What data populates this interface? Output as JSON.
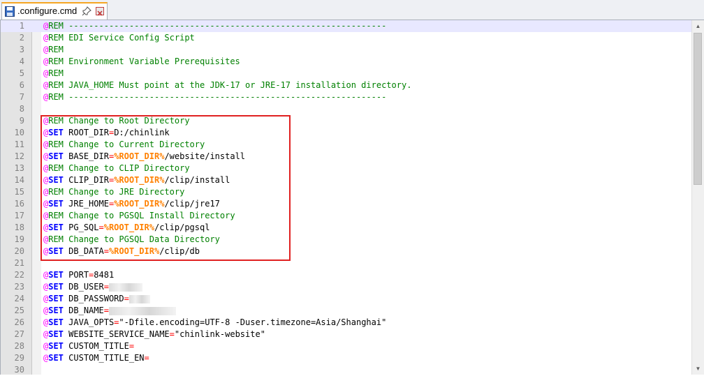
{
  "tab": {
    "title": ".configure.cmd",
    "icon": "save-disk-icon",
    "pin_icon": "pin-icon",
    "close_icon": "close-icon"
  },
  "colors": {
    "at": "#ff00ff",
    "rem": "#008000",
    "set": "#0000ff",
    "operator": "#ff0000",
    "variable": "#ff8000",
    "highlight": "#e02020"
  },
  "lines": [
    {
      "n": "1",
      "current": true,
      "tokens": [
        {
          "t": "at",
          "v": "@"
        },
        {
          "t": "kw-rem",
          "v": "REM"
        },
        {
          "t": "cmt",
          "v": " ---------------------------------------------------------------"
        }
      ]
    },
    {
      "n": "2",
      "tokens": [
        {
          "t": "at",
          "v": "@"
        },
        {
          "t": "kw-rem",
          "v": "REM"
        },
        {
          "t": "cmt",
          "v": " EDI Service Config Script"
        }
      ]
    },
    {
      "n": "3",
      "tokens": [
        {
          "t": "at",
          "v": "@"
        },
        {
          "t": "kw-rem",
          "v": "REM"
        }
      ]
    },
    {
      "n": "4",
      "tokens": [
        {
          "t": "at",
          "v": "@"
        },
        {
          "t": "kw-rem",
          "v": "REM"
        },
        {
          "t": "cmt",
          "v": " Environment Variable Prerequisites"
        }
      ]
    },
    {
      "n": "5",
      "tokens": [
        {
          "t": "at",
          "v": "@"
        },
        {
          "t": "kw-rem",
          "v": "REM"
        }
      ]
    },
    {
      "n": "6",
      "tokens": [
        {
          "t": "at",
          "v": "@"
        },
        {
          "t": "kw-rem",
          "v": "REM"
        },
        {
          "t": "cmt",
          "v": " JAVA_HOME Must point at the JDK-17 or JRE-17 installation directory."
        }
      ]
    },
    {
      "n": "7",
      "tokens": [
        {
          "t": "at",
          "v": "@"
        },
        {
          "t": "kw-rem",
          "v": "REM"
        },
        {
          "t": "cmt",
          "v": " ---------------------------------------------------------------"
        }
      ]
    },
    {
      "n": "8",
      "tokens": []
    },
    {
      "n": "9",
      "tokens": [
        {
          "t": "at",
          "v": "@"
        },
        {
          "t": "kw-rem",
          "v": "REM"
        },
        {
          "t": "cmt",
          "v": " Change to Root Directory"
        }
      ]
    },
    {
      "n": "10",
      "tokens": [
        {
          "t": "at",
          "v": "@"
        },
        {
          "t": "kw-set",
          "v": "SET"
        },
        {
          "t": "txt",
          "v": " ROOT_DIR"
        },
        {
          "t": "op",
          "v": "="
        },
        {
          "t": "txt",
          "v": "D:/chinlink"
        }
      ]
    },
    {
      "n": "11",
      "tokens": [
        {
          "t": "at",
          "v": "@"
        },
        {
          "t": "kw-rem",
          "v": "REM"
        },
        {
          "t": "cmt",
          "v": " Change to Current Directory"
        }
      ]
    },
    {
      "n": "12",
      "tokens": [
        {
          "t": "at",
          "v": "@"
        },
        {
          "t": "kw-set",
          "v": "SET"
        },
        {
          "t": "txt",
          "v": " BASE_DIR"
        },
        {
          "t": "op",
          "v": "="
        },
        {
          "t": "var",
          "v": "%ROOT_DIR%"
        },
        {
          "t": "txt",
          "v": "/website/install"
        }
      ]
    },
    {
      "n": "13",
      "tokens": [
        {
          "t": "at",
          "v": "@"
        },
        {
          "t": "kw-rem",
          "v": "REM"
        },
        {
          "t": "cmt",
          "v": " Change to CLIP Directory"
        }
      ]
    },
    {
      "n": "14",
      "tokens": [
        {
          "t": "at",
          "v": "@"
        },
        {
          "t": "kw-set",
          "v": "SET"
        },
        {
          "t": "txt",
          "v": " CLIP_DIR"
        },
        {
          "t": "op",
          "v": "="
        },
        {
          "t": "var",
          "v": "%ROOT_DIR%"
        },
        {
          "t": "txt",
          "v": "/clip/install"
        }
      ]
    },
    {
      "n": "15",
      "tokens": [
        {
          "t": "at",
          "v": "@"
        },
        {
          "t": "kw-rem",
          "v": "REM"
        },
        {
          "t": "cmt",
          "v": " Change to JRE Directory"
        }
      ]
    },
    {
      "n": "16",
      "tokens": [
        {
          "t": "at",
          "v": "@"
        },
        {
          "t": "kw-set",
          "v": "SET"
        },
        {
          "t": "txt",
          "v": " JRE_HOME"
        },
        {
          "t": "op",
          "v": "="
        },
        {
          "t": "var",
          "v": "%ROOT_DIR%"
        },
        {
          "t": "txt",
          "v": "/clip/jre17"
        }
      ]
    },
    {
      "n": "17",
      "tokens": [
        {
          "t": "at",
          "v": "@"
        },
        {
          "t": "kw-rem",
          "v": "REM"
        },
        {
          "t": "cmt",
          "v": " Change to PGSQL Install Directory"
        }
      ]
    },
    {
      "n": "18",
      "tokens": [
        {
          "t": "at",
          "v": "@"
        },
        {
          "t": "kw-set",
          "v": "SET"
        },
        {
          "t": "txt",
          "v": " PG_SQL"
        },
        {
          "t": "op",
          "v": "="
        },
        {
          "t": "var",
          "v": "%ROOT_DIR%"
        },
        {
          "t": "txt",
          "v": "/clip/pgsql"
        }
      ]
    },
    {
      "n": "19",
      "tokens": [
        {
          "t": "at",
          "v": "@"
        },
        {
          "t": "kw-rem",
          "v": "REM"
        },
        {
          "t": "cmt",
          "v": " Change to PGSQL Data Directory"
        }
      ]
    },
    {
      "n": "20",
      "tokens": [
        {
          "t": "at",
          "v": "@"
        },
        {
          "t": "kw-set",
          "v": "SET"
        },
        {
          "t": "txt",
          "v": " DB_DATA"
        },
        {
          "t": "op",
          "v": "="
        },
        {
          "t": "var",
          "v": "%ROOT_DIR%"
        },
        {
          "t": "txt",
          "v": "/clip/db"
        }
      ]
    },
    {
      "n": "21",
      "tokens": []
    },
    {
      "n": "22",
      "tokens": [
        {
          "t": "at",
          "v": "@"
        },
        {
          "t": "kw-set",
          "v": "SET"
        },
        {
          "t": "txt",
          "v": " PORT"
        },
        {
          "t": "op",
          "v": "="
        },
        {
          "t": "txt",
          "v": "8481"
        }
      ]
    },
    {
      "n": "23",
      "tokens": [
        {
          "t": "at",
          "v": "@"
        },
        {
          "t": "kw-set",
          "v": "SET"
        },
        {
          "t": "txt",
          "v": " DB_USER"
        },
        {
          "t": "op",
          "v": "="
        },
        {
          "t": "blur",
          "w": 48
        }
      ]
    },
    {
      "n": "24",
      "tokens": [
        {
          "t": "at",
          "v": "@"
        },
        {
          "t": "kw-set",
          "v": "SET"
        },
        {
          "t": "txt",
          "v": " DB_PASSWORD"
        },
        {
          "t": "op",
          "v": "="
        },
        {
          "t": "blur",
          "w": 30
        }
      ]
    },
    {
      "n": "25",
      "tokens": [
        {
          "t": "at",
          "v": "@"
        },
        {
          "t": "kw-set",
          "v": "SET"
        },
        {
          "t": "txt",
          "v": " DB_NAME"
        },
        {
          "t": "op",
          "v": "="
        },
        {
          "t": "blur",
          "w": 96
        }
      ]
    },
    {
      "n": "26",
      "tokens": [
        {
          "t": "at",
          "v": "@"
        },
        {
          "t": "kw-set",
          "v": "SET"
        },
        {
          "t": "txt",
          "v": " JAVA_OPTS"
        },
        {
          "t": "op",
          "v": "="
        },
        {
          "t": "txt",
          "v": "\"-Dfile.encoding=UTF-8 -Duser.timezone=Asia/Shanghai\""
        }
      ]
    },
    {
      "n": "27",
      "tokens": [
        {
          "t": "at",
          "v": "@"
        },
        {
          "t": "kw-set",
          "v": "SET"
        },
        {
          "t": "txt",
          "v": " WEBSITE_SERVICE_NAME"
        },
        {
          "t": "op",
          "v": "="
        },
        {
          "t": "txt",
          "v": "\"chinlink-website\""
        }
      ]
    },
    {
      "n": "28",
      "tokens": [
        {
          "t": "at",
          "v": "@"
        },
        {
          "t": "kw-set",
          "v": "SET"
        },
        {
          "t": "txt",
          "v": " CUSTOM_TITLE"
        },
        {
          "t": "op",
          "v": "="
        }
      ]
    },
    {
      "n": "29",
      "tokens": [
        {
          "t": "at",
          "v": "@"
        },
        {
          "t": "kw-set",
          "v": "SET"
        },
        {
          "t": "txt",
          "v": " CUSTOM_TITLE_EN"
        },
        {
          "t": "op",
          "v": "="
        }
      ]
    },
    {
      "n": "30",
      "tokens": []
    }
  ]
}
